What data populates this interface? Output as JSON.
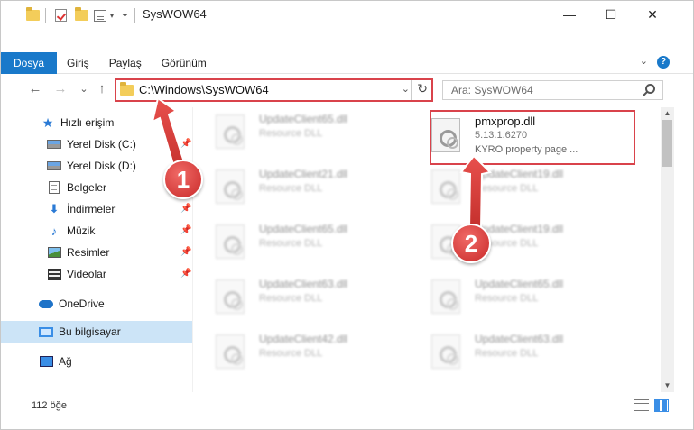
{
  "window": {
    "title": "SysWOW64",
    "controls": {
      "minimize": "—",
      "maximize": "☐",
      "close": "✕"
    }
  },
  "ribbon": {
    "tabs": [
      "Dosya",
      "Giriş",
      "Paylaş",
      "Görünüm"
    ],
    "help": "?",
    "collapse": "⌄"
  },
  "nav": {
    "back": "←",
    "forward": "→",
    "recent": "⌄",
    "up": "↑"
  },
  "address": {
    "path": "C:\\Windows\\SysWOW64",
    "dropdown": "⌄",
    "refresh": "↻"
  },
  "search": {
    "placeholder": "Ara: SysWOW64"
  },
  "sidebar": {
    "items": [
      {
        "label": "Hızlı erişim",
        "icon": "star-icon",
        "pinned": false
      },
      {
        "label": "Yerel Disk (C:)",
        "icon": "drive-icon",
        "pinned": true
      },
      {
        "label": "Yerel Disk (D:)",
        "icon": "drive-icon",
        "pinned": false
      },
      {
        "label": "Belgeler",
        "icon": "documents-icon",
        "pinned": false
      },
      {
        "label": "İndirmeler",
        "icon": "downloads-icon",
        "pinned": true
      },
      {
        "label": "Müzik",
        "icon": "music-icon",
        "pinned": true
      },
      {
        "label": "Resimler",
        "icon": "pictures-icon",
        "pinned": true
      },
      {
        "label": "Videolar",
        "icon": "videos-icon",
        "pinned": true
      },
      {
        "label": "OneDrive",
        "icon": "onedrive-icon",
        "pinned": false
      },
      {
        "label": "Bu bilgisayar",
        "icon": "computer-icon",
        "pinned": false,
        "selected": true
      },
      {
        "label": "Ağ",
        "icon": "network-icon",
        "pinned": false
      }
    ],
    "pin_glyph": "📌"
  },
  "files": {
    "left_column": [
      {
        "name": "UpdateClient65.dll",
        "type": "Resource DLL"
      },
      {
        "name": "UpdateClient21.dll",
        "type": "Resource DLL"
      },
      {
        "name": "UpdateClient65.dll",
        "type": "Resource DLL"
      },
      {
        "name": "UpdateClient63.dll",
        "type": "Resource DLL"
      },
      {
        "name": "UpdateClient42.dll",
        "type": "Resource DLL"
      }
    ],
    "right_column": [
      {
        "name": "pmxprop.dll",
        "version": "5.13.1.6270",
        "type": "KYRO property page ...",
        "highlighted": true
      },
      {
        "name": "UpdateClient19.dll",
        "type": "Resource DLL"
      },
      {
        "name": "UpdateClient19.dll",
        "type": "Resource DLL"
      },
      {
        "name": "UpdateClient65.dll",
        "type": "Resource DLL"
      },
      {
        "name": "UpdateClient63.dll",
        "type": "Resource DLL"
      }
    ]
  },
  "status": {
    "count": "112 öğe"
  },
  "callouts": {
    "step1": "1",
    "step2": "2"
  },
  "colors": {
    "accent": "#1979ca",
    "highlight": "#d9434b",
    "selected": "#cce4f7"
  }
}
